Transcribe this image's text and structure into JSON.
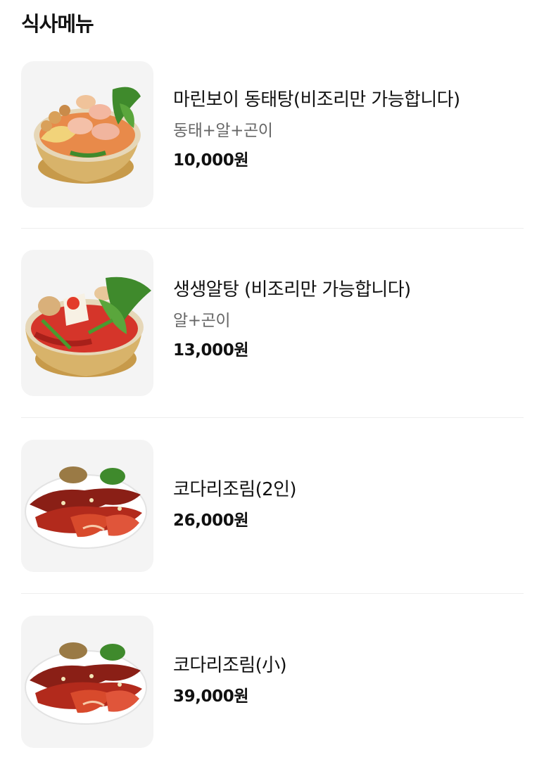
{
  "section": {
    "title": "식사메뉴"
  },
  "items": [
    {
      "name": "마린보이 동태탕(비조리만 가능합니다)",
      "description": "동태+알+곤이",
      "price": "10,000원",
      "image_icon": "soup-bowl-icon"
    },
    {
      "name": "생생알탕 (비조리만 가능합니다)",
      "description": "알+곤이",
      "price": "13,000원",
      "image_icon": "soup-bowl-icon"
    },
    {
      "name": "코다리조림(2인)",
      "description": "",
      "price": "26,000원",
      "image_icon": "braised-fish-plate-icon"
    },
    {
      "name": "코다리조림(小)",
      "description": "",
      "price": "39,000원",
      "image_icon": "braised-fish-plate-icon"
    }
  ],
  "colors": {
    "text_primary": "#111111",
    "text_secondary": "#666666",
    "divider": "#eeeeee",
    "thumb_bg": "#f4f4f4"
  }
}
